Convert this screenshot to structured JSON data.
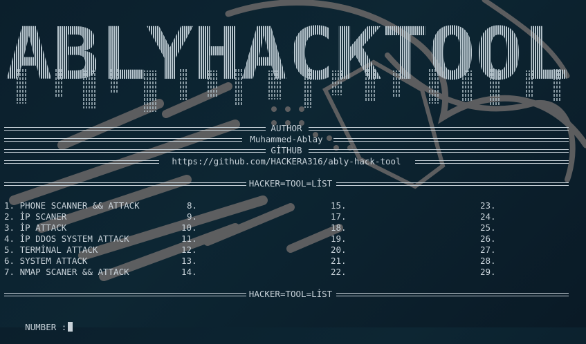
{
  "banner_text": "ABLYHACKTOOL",
  "header": {
    "author_label": "AUTHOR",
    "author_name": "Muhammed-Ablay",
    "github_label": "GİTHUB",
    "github_url": "https://github.com/HACKERA316/ably-hack-tool",
    "list_title_top": "HACKER=TOOL=LİST",
    "list_title_bottom": "HACKER=TOOL=LİST"
  },
  "menu": {
    "col1": [
      "1. PHONE SCANNER && ATTACK",
      "2. İP SCANER",
      "3. İP ATTACK",
      "4. İP DDOS SYSTEM ATTACK",
      "5. TERMİNAL ATTACK",
      "6. SYSTEM ATTACK",
      "7. NMAP SCANER && ATTACK"
    ],
    "col2": [
      "8.",
      "9.",
      "10.",
      "11.",
      "12.",
      "13.",
      "14."
    ],
    "col3": [
      "15.",
      "17.",
      "18.",
      "19.",
      "20.",
      "21.",
      "22."
    ],
    "col4": [
      "23.",
      "24.",
      "25.",
      "26.",
      "27.",
      "28.",
      "29."
    ]
  },
  "prompt": {
    "label": "NUMBER :"
  },
  "colors": {
    "background": "#0c2330",
    "text": "#c9d3da",
    "banner": "#b9c7cf",
    "wallpaper_stroke": "#6b6868"
  }
}
